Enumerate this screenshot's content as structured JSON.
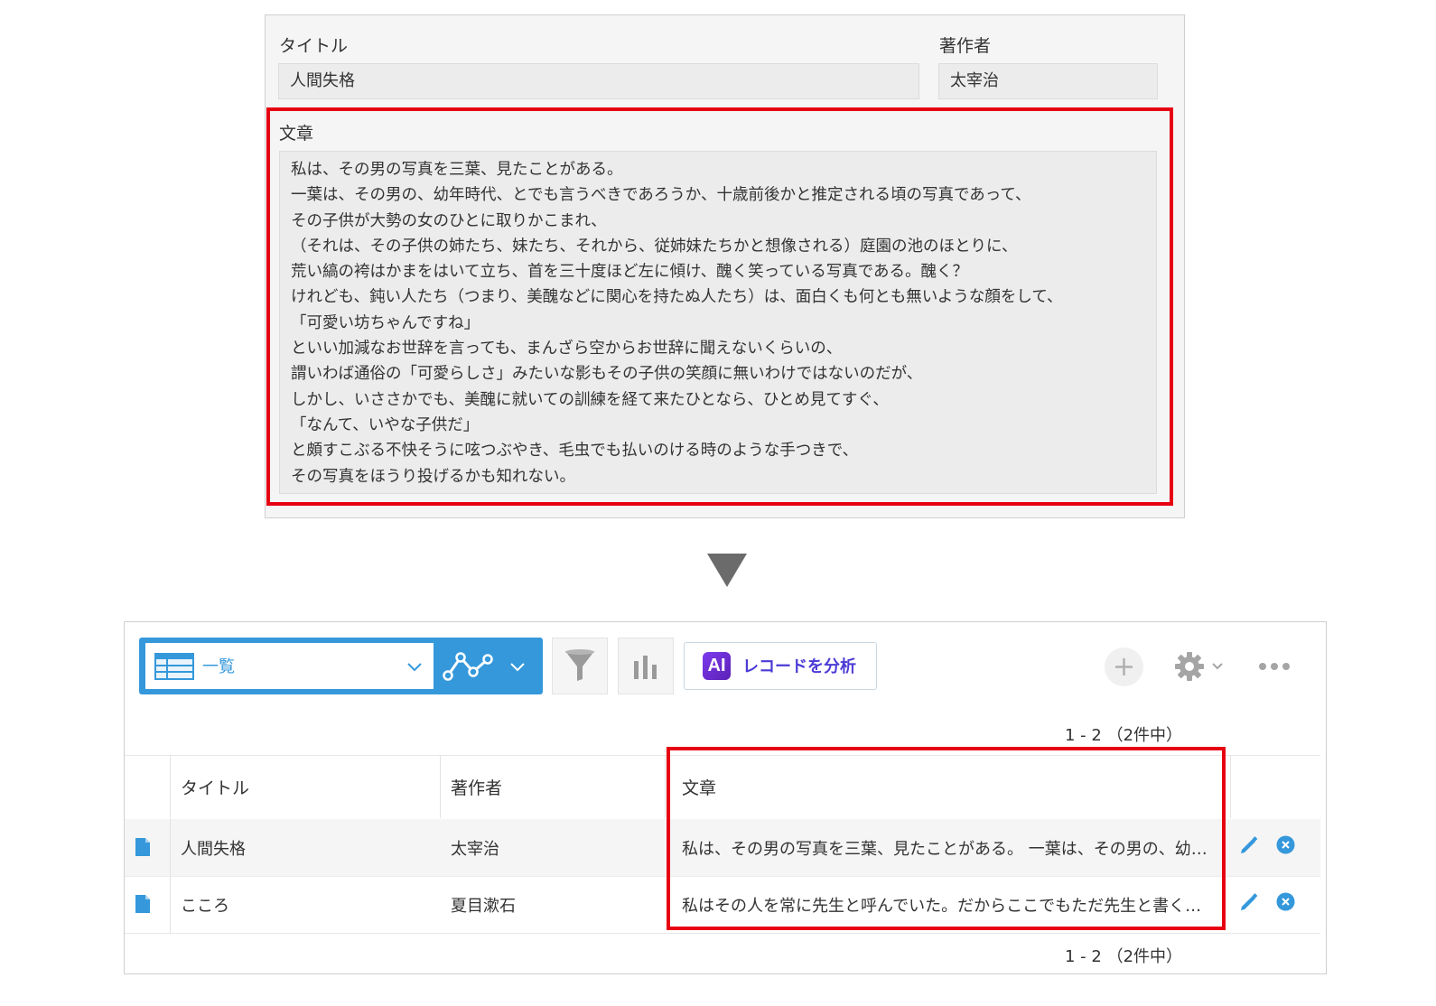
{
  "form": {
    "title_label": "タイトル",
    "title_value": "人間失格",
    "author_label": "著作者",
    "author_value": "太宰治",
    "body_label": "文章",
    "body_lines": [
      "私は、その男の写真を三葉、見たことがある。",
      "一葉は、その男の、幼年時代、とでも言うべきであろうか、十歳前後かと推定される頃の写真であって、",
      "その子供が大勢の女のひとに取りかこまれ、",
      "（それは、その子供の姉たち、妹たち、それから、従姉妹たちかと想像される）庭園の池のほとりに、",
      "荒い縞の袴はかまをはいて立ち、首を三十度ほど左に傾け、醜く笑っている写真である。醜く？",
      "けれども、鈍い人たち（つまり、美醜などに関心を持たぬ人たち）は、面白くも何とも無いような顔をして、",
      "「可愛い坊ちゃんですね」",
      "といい加減なお世辞を言っても、まんざら空からお世辞に聞えないくらいの、",
      "謂いわば通俗の「可愛らしさ」みたいな影もその子供の笑顔に無いわけではないのだが、",
      "しかし、いささかでも、美醜に就いての訓練を経て来たひとなら、ひとめ見てすぐ、",
      "「なんて、いやな子供だ」",
      "と頗すこぶる不快そうに呟つぶやき、毛虫でも払いのける時のような手つきで、",
      "その写真をほうり投げるかも知れない。"
    ]
  },
  "toolbar": {
    "view_name": "一覧",
    "ai_button_label": "レコードを分析",
    "ai_badge": "AI"
  },
  "list": {
    "pager_top": "1 - 2 （2件中）",
    "pager_bottom": "1 - 2 （2件中）",
    "columns": [
      "タイトル",
      "著作者",
      "文章"
    ],
    "rows": [
      {
        "title": "人間失格",
        "author": "太宰治",
        "body": "私は、その男の写真を三葉、見たことがある。 一葉は、その男の、幼…"
      },
      {
        "title": "こころ",
        "author": "夏目漱石",
        "body": "私はその人を常に先生と呼んでいた。だからここでもただ先生と書く…"
      }
    ]
  },
  "colors": {
    "accent": "#3498db",
    "highlight": "#e60012",
    "ai_purple": "#5b21b6"
  }
}
